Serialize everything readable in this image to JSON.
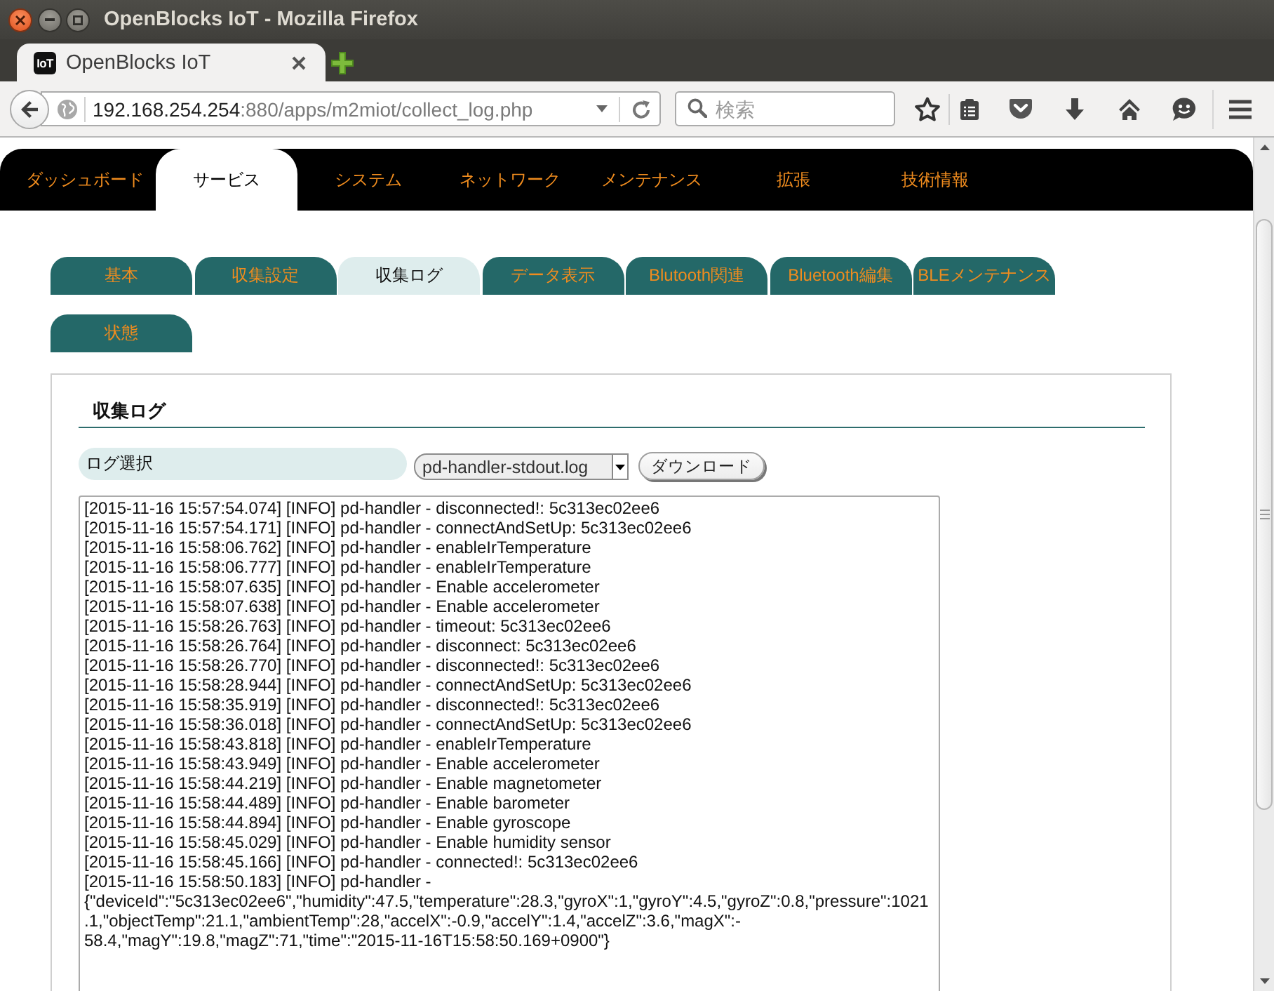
{
  "window": {
    "title": "OpenBlocks IoT - Mozilla Firefox"
  },
  "browser_tabs": [
    {
      "label": "OpenBlocks IoT",
      "favicon_text": "IoT",
      "selected": true
    }
  ],
  "address_bar": {
    "host": "192.168.254.254",
    "path": ":880/apps/m2miot/collect_log.php"
  },
  "search": {
    "placeholder": "検索"
  },
  "nav": [
    {
      "label": "ダッシュボード",
      "selected": false
    },
    {
      "label": "サービス",
      "selected": true
    },
    {
      "label": "システム",
      "selected": false
    },
    {
      "label": "ネットワーク",
      "selected": false
    },
    {
      "label": "メンテナンス",
      "selected": false
    },
    {
      "label": "拡張",
      "selected": false
    },
    {
      "label": "技術情報",
      "selected": false
    }
  ],
  "sub_tabs": [
    {
      "label": "基本",
      "selected": false
    },
    {
      "label": "収集設定",
      "selected": false
    },
    {
      "label": "収集ログ",
      "selected": true
    },
    {
      "label": "データ表示",
      "selected": false
    },
    {
      "label": "Blutooth関連",
      "selected": false
    },
    {
      "label": "Bluetooth編集",
      "selected": false
    },
    {
      "label": "BLEメンテナンス",
      "selected": false
    },
    {
      "label": "状態",
      "selected": false
    }
  ],
  "panel": {
    "title": "収集ログ",
    "select_label": "ログ選択",
    "selected_file": "pd-handler-stdout.log",
    "download_button": "ダウンロード",
    "log_lines": [
      "[2015-11-16 15:57:54.074] [INFO] pd-handler - disconnected!: 5c313ec02ee6",
      "[2015-11-16 15:57:54.171] [INFO] pd-handler - connectAndSetUp: 5c313ec02ee6",
      "[2015-11-16 15:58:06.762] [INFO] pd-handler - enableIrTemperature",
      "[2015-11-16 15:58:06.777] [INFO] pd-handler - enableIrTemperature",
      "[2015-11-16 15:58:07.635] [INFO] pd-handler - Enable accelerometer",
      "[2015-11-16 15:58:07.638] [INFO] pd-handler - Enable accelerometer",
      "[2015-11-16 15:58:26.763] [INFO] pd-handler - timeout: 5c313ec02ee6",
      "[2015-11-16 15:58:26.764] [INFO] pd-handler - disconnect: 5c313ec02ee6",
      "[2015-11-16 15:58:26.770] [INFO] pd-handler - disconnected!: 5c313ec02ee6",
      "[2015-11-16 15:58:28.944] [INFO] pd-handler - connectAndSetUp: 5c313ec02ee6",
      "[2015-11-16 15:58:35.919] [INFO] pd-handler - disconnected!: 5c313ec02ee6",
      "[2015-11-16 15:58:36.018] [INFO] pd-handler - connectAndSetUp: 5c313ec02ee6",
      "[2015-11-16 15:58:43.818] [INFO] pd-handler - enableIrTemperature",
      "[2015-11-16 15:58:43.949] [INFO] pd-handler - Enable accelerometer",
      "[2015-11-16 15:58:44.219] [INFO] pd-handler - Enable magnetometer",
      "[2015-11-16 15:58:44.489] [INFO] pd-handler - Enable barometer",
      "[2015-11-16 15:58:44.894] [INFO] pd-handler - Enable gyroscope",
      "[2015-11-16 15:58:45.029] [INFO] pd-handler - Enable humidity sensor",
      "[2015-11-16 15:58:45.166] [INFO] pd-handler - connected!: 5c313ec02ee6",
      "[2015-11-16 15:58:50.183] [INFO] pd-handler -",
      "{\"deviceId\":\"5c313ec02ee6\",\"humidity\":47.5,\"temperature\":28.3,\"gyroX\":1,\"gyroY\":4.5,\"gyroZ\":0.8,\"pressure\":1021",
      ".1,\"objectTemp\":21.1,\"ambientTemp\":28,\"accelX\":-0.9,\"accelY\":1.4,\"accelZ\":3.6,\"magX\":-",
      "58.4,\"magY\":19.8,\"magZ\":71,\"time\":\"2015-11-16T15:58:50.169+0900\"}"
    ]
  }
}
